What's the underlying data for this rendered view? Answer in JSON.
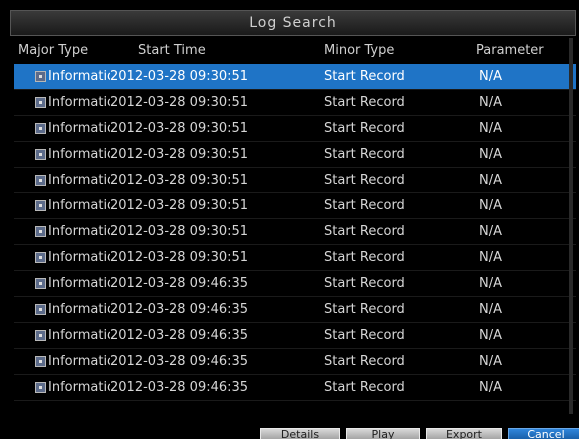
{
  "window": {
    "title": "Log Search"
  },
  "columns": {
    "major_type": "Major Type",
    "start_time": "Start Time",
    "minor_type": "Minor Type",
    "parameter": "Parameter"
  },
  "rows": [
    {
      "major": "Information",
      "time": "2012-03-28 09:30:51",
      "minor": "Start Record",
      "param": "N/A"
    },
    {
      "major": "Information",
      "time": "2012-03-28 09:30:51",
      "minor": "Start Record",
      "param": "N/A"
    },
    {
      "major": "Information",
      "time": "2012-03-28 09:30:51",
      "minor": "Start Record",
      "param": "N/A"
    },
    {
      "major": "Information",
      "time": "2012-03-28 09:30:51",
      "minor": "Start Record",
      "param": "N/A"
    },
    {
      "major": "Information",
      "time": "2012-03-28 09:30:51",
      "minor": "Start Record",
      "param": "N/A"
    },
    {
      "major": "Information",
      "time": "2012-03-28 09:30:51",
      "minor": "Start Record",
      "param": "N/A"
    },
    {
      "major": "Information",
      "time": "2012-03-28 09:30:51",
      "minor": "Start Record",
      "param": "N/A"
    },
    {
      "major": "Information",
      "time": "2012-03-28 09:30:51",
      "minor": "Start Record",
      "param": "N/A"
    },
    {
      "major": "Information",
      "time": "2012-03-28 09:46:35",
      "minor": "Start Record",
      "param": "N/A"
    },
    {
      "major": "Information",
      "time": "2012-03-28 09:46:35",
      "minor": "Start Record",
      "param": "N/A"
    },
    {
      "major": "Information",
      "time": "2012-03-28 09:46:35",
      "minor": "Start Record",
      "param": "N/A"
    },
    {
      "major": "Information",
      "time": "2012-03-28 09:46:35",
      "minor": "Start Record",
      "param": "N/A"
    },
    {
      "major": "Information",
      "time": "2012-03-28 09:46:35",
      "minor": "Start Record",
      "param": "N/A"
    }
  ],
  "selected_row": 0,
  "buttons": {
    "b1": "Details",
    "b2": "Play",
    "b3": "Export",
    "b4": "Cancel"
  },
  "colors": {
    "selection": "#1f74c6",
    "background": "#000000"
  }
}
